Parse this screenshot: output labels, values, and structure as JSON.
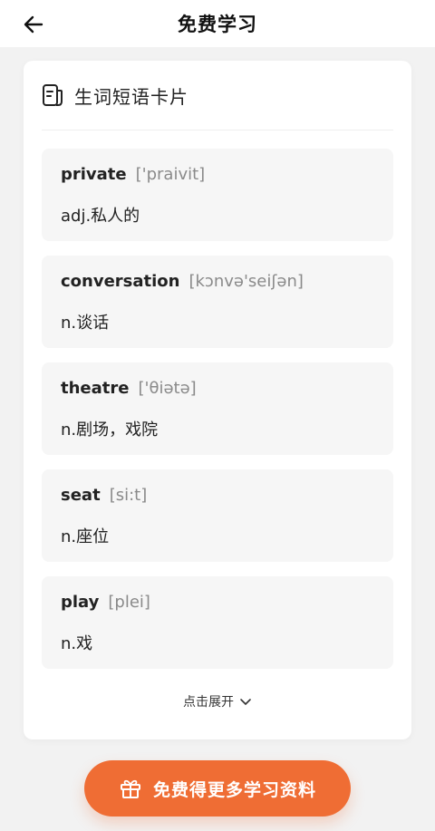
{
  "header": {
    "title": "免费学习",
    "back_icon": "arrow-left-icon"
  },
  "card": {
    "title": "生词短语卡片",
    "icon": "flashcard-icon",
    "items": [
      {
        "word": "private",
        "phonetic": "['praivit]",
        "meaning": "adj.私人的"
      },
      {
        "word": "conversation",
        "phonetic": "[kɔnvə'seiʃən]",
        "meaning": "n.谈话"
      },
      {
        "word": "theatre",
        "phonetic": "['θiətə]",
        "meaning": "n.剧场，戏院"
      },
      {
        "word": "seat",
        "phonetic": "[si:t]",
        "meaning": "n.座位"
      },
      {
        "word": "play",
        "phonetic": "[plei]",
        "meaning": "n.戏"
      }
    ],
    "expand_label": "点击展开"
  },
  "cta": {
    "label": "免费得更多学习资料",
    "icon": "gift-icon",
    "color": "#ef6d34"
  }
}
